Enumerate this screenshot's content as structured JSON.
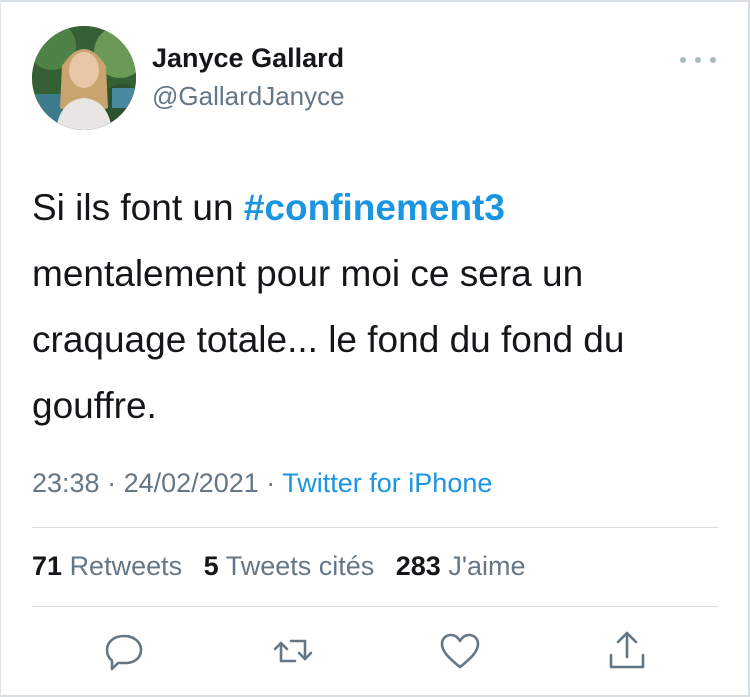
{
  "author": {
    "name": "Janyce Gallard",
    "handle": "@GallardJanyce"
  },
  "tweet": {
    "text_before": "Si ils font un ",
    "hashtag": "#confinement3",
    "text_line2": "mentalement pour moi ce sera un",
    "text_line3": "craquage totale... le fond du fond du",
    "text_line4": "gouffre."
  },
  "meta": {
    "time": "23:38",
    "date": "24/02/2021",
    "separator": "·",
    "source": "Twitter for iPhone"
  },
  "stats": {
    "retweets_count": "71",
    "retweets_label": "Retweets",
    "quotes_count": "5",
    "quotes_label": "Tweets cités",
    "likes_count": "283",
    "likes_label": "J'aime"
  },
  "icons": {
    "more": "more-dots-icon",
    "reply": "reply-icon",
    "retweet": "retweet-icon",
    "like": "heart-icon",
    "share": "share-icon"
  },
  "colors": {
    "text": "#14171a",
    "secondary": "#657786",
    "link": "#1b95e0",
    "icon": "#657786"
  }
}
